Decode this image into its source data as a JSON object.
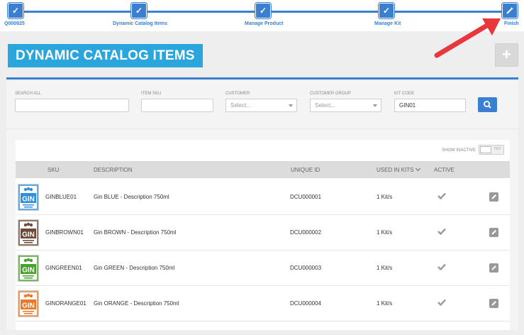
{
  "stepper": {
    "steps": [
      {
        "label": "Q000925"
      },
      {
        "label": "Dynamic Catalog Items"
      },
      {
        "label": "Manage Product"
      },
      {
        "label": "Manage Kit"
      },
      {
        "label": "Finish"
      }
    ]
  },
  "header": {
    "title": "DYNAMIC CATALOG ITEMS",
    "add_label": "+"
  },
  "filters": {
    "search_all_label": "SEARCH ALL",
    "item_sku_label": "ITEM SKU",
    "customer_label": "CUSTOMER",
    "customer_placeholder": "Select...",
    "customer_group_label": "CUSTOMER GROUP",
    "customer_group_placeholder": "Select...",
    "kit_code_label": "KIT CODE",
    "kit_code_value": "GIN01"
  },
  "table": {
    "show_inactive_label": "SHOW INACTIVE",
    "toggle_label": "NO",
    "headers": {
      "sku": "SKU",
      "description": "DESCRIPTION",
      "unique_id": "UNIQUE ID",
      "used_in_kits": "USED IN KITS",
      "active": "ACTIVE"
    },
    "rows": [
      {
        "sku": "GINBLUE01",
        "description": "Gin BLUE - Description 750ml",
        "unique_id": "DCU000001",
        "used_in_kits": "1 Kit/s",
        "color": "#2f8fd8",
        "label_text": "GIN"
      },
      {
        "sku": "GINBROWN01",
        "description": "Gin BROWN - Description 750ml",
        "unique_id": "DCU000002",
        "used_in_kits": "1 Kit/s",
        "color": "#6b4a3a",
        "label_text": "GIN"
      },
      {
        "sku": "GINGREEN01",
        "description": "Gin GREEN - Description 750ml",
        "unique_id": "DCU000003",
        "used_in_kits": "1 Kit/s",
        "color": "#4aa02c",
        "label_text": "GIN"
      },
      {
        "sku": "GINORANGE01",
        "description": "Gin ORANGE - Description 750ml",
        "unique_id": "DCU000004",
        "used_in_kits": "1 Kit/s",
        "color": "#e9782c",
        "label_text": "GIN"
      }
    ]
  },
  "colors": {
    "accent": "#3a7fd0",
    "title_bg": "#2aa6dd",
    "arrow": "#e8383d"
  },
  "icons": {
    "step": "check-icon",
    "final_step": "wand-icon",
    "search": "search-icon",
    "active": "check-icon",
    "edit": "pencil-icon"
  }
}
